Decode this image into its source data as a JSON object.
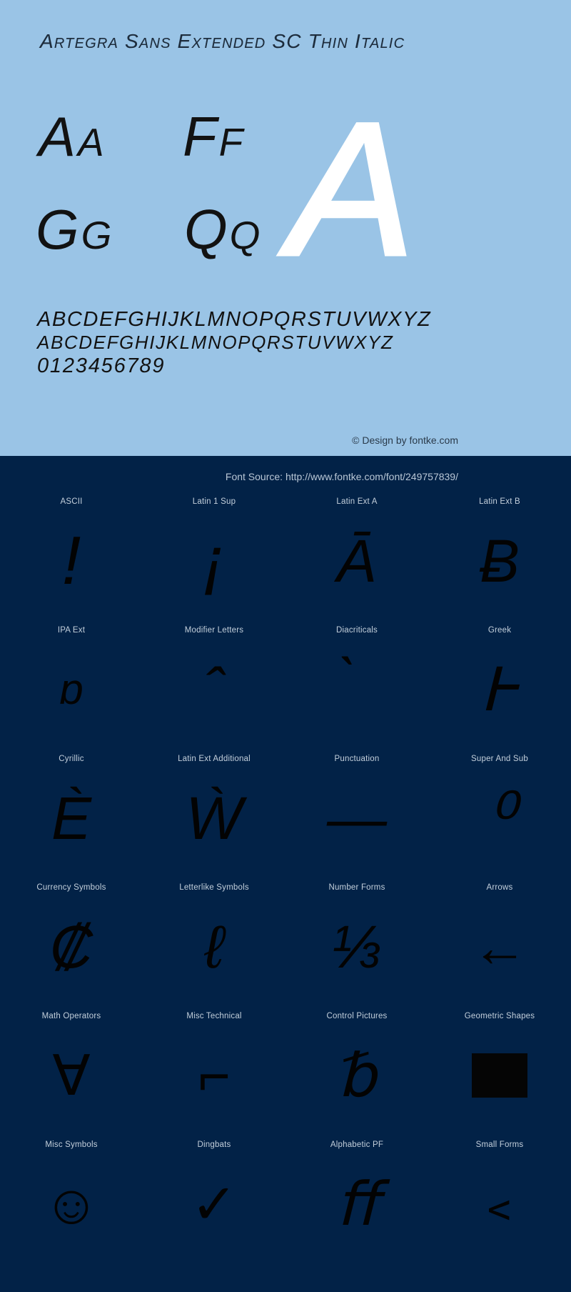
{
  "specimen": {
    "title": "Artegra Sans Extended SC Thin Italic",
    "pairs": [
      {
        "name": "aa",
        "text": "Aa"
      },
      {
        "name": "ff",
        "text": "Ff"
      },
      {
        "name": "gg",
        "text": "Gg"
      },
      {
        "name": "qq",
        "text": "Qq"
      }
    ],
    "big_letter": "A",
    "alphabet_upper": "ABCDEFGHIJKLMNOPQRSTUVWXYZ",
    "alphabet_small": "ABCDEFGHIJKLMNOPQRSTUVWXYZ",
    "digits": "0123456789",
    "credit": "© Design by fontke.com",
    "colors": {
      "background": "#9AC4E6",
      "text": "#121212",
      "title": "#1D2C3C",
      "big_letter": "#FFFFFF"
    }
  },
  "source": {
    "label": "Font Source: http://www.fontke.com/font/249757839/"
  },
  "blocks": {
    "colors": {
      "background": "#022247",
      "label": "#C3CFDB",
      "glyph": "#030303"
    },
    "items": [
      {
        "label": "ASCII",
        "glyph": "!",
        "style": "tall-g"
      },
      {
        "label": "Latin 1 Sup",
        "glyph": "¡",
        "style": "tall-g"
      },
      {
        "label": "Latin Ext A",
        "glyph": "Ā",
        "style": ""
      },
      {
        "label": "Latin Ext B",
        "glyph": "Ƀ",
        "style": ""
      },
      {
        "label": "IPA Ext",
        "glyph": "ɒ",
        "style": "small-g"
      },
      {
        "label": "Modifier Letters",
        "glyph": "ˆ",
        "style": ""
      },
      {
        "label": "Diacriticals",
        "glyph": "̀",
        "style": ""
      },
      {
        "label": "Greek",
        "glyph": "Ͱ",
        "style": ""
      },
      {
        "label": "Cyrillic",
        "glyph": "Ѐ",
        "style": ""
      },
      {
        "label": "Latin Ext Additional",
        "glyph": "Ẁ",
        "style": ""
      },
      {
        "label": "Punctuation",
        "glyph": "—",
        "style": ""
      },
      {
        "label": "Super And Sub",
        "glyph": "⁰",
        "style": "tall-g"
      },
      {
        "label": "Currency Symbols",
        "glyph": "₡",
        "style": ""
      },
      {
        "label": "Letterlike Symbols",
        "glyph": "ℓ",
        "style": ""
      },
      {
        "label": "Number Forms",
        "glyph": "⅓",
        "style": ""
      },
      {
        "label": "Arrows",
        "glyph": "←",
        "style": "sym-g"
      },
      {
        "label": "Math Operators",
        "glyph": "∀",
        "style": "sym-g"
      },
      {
        "label": "Misc Technical",
        "glyph": "⌐",
        "style": "sym-g"
      },
      {
        "label": "Control Pictures",
        "glyph": "␢",
        "style": ""
      },
      {
        "label": "Geometric Shapes",
        "glyph": "",
        "style": "square"
      },
      {
        "label": "Misc Symbols",
        "glyph": "☺",
        "style": "sym-g"
      },
      {
        "label": "Dingbats",
        "glyph": "✓",
        "style": "sym-g"
      },
      {
        "label": "Alphabetic PF",
        "glyph": "ﬀ",
        "style": ""
      },
      {
        "label": "Small Forms",
        "glyph": "﹤",
        "style": "sym-g"
      }
    ]
  }
}
